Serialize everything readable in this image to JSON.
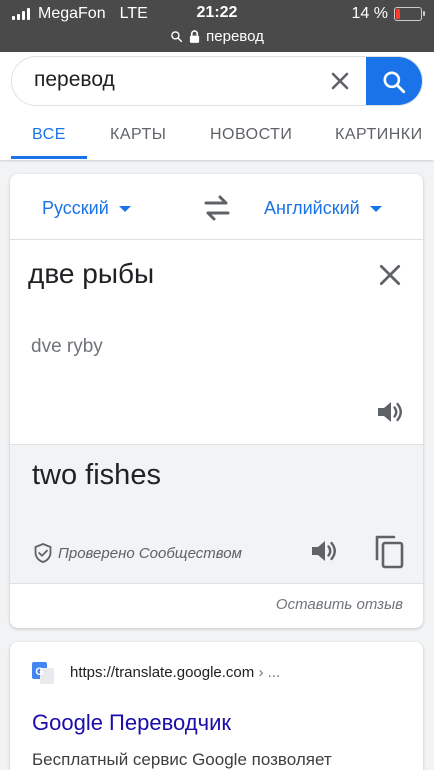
{
  "status_bar": {
    "carrier": "MegaFon",
    "network": "LTE",
    "time": "21:22",
    "battery": "14 %",
    "battery_level": 0.14,
    "url": "перевод"
  },
  "search": {
    "query": "перевод"
  },
  "tabs": [
    {
      "label": "ВСЕ"
    },
    {
      "label": "КАРТЫ"
    },
    {
      "label": "НОВОСТИ"
    },
    {
      "label": "КАРТИНКИ"
    }
  ],
  "translator": {
    "source_lang": "Русский",
    "target_lang": "Английский",
    "source_text": "две рыбы",
    "transliteration": "dve ryby",
    "translation": "two fishes",
    "verified_label": "Проверено Сообществом",
    "feedback_label": "Оставить отзыв"
  },
  "result": {
    "url": "https://translate.google.com",
    "url_suffix": "› ...",
    "title": "Google Переводчик",
    "snippet": "Бесплатный сервис Google позволяет"
  },
  "colors": {
    "accent": "#1a73e8",
    "link": "#1a0dab",
    "battery_low": "#ff3b30"
  }
}
